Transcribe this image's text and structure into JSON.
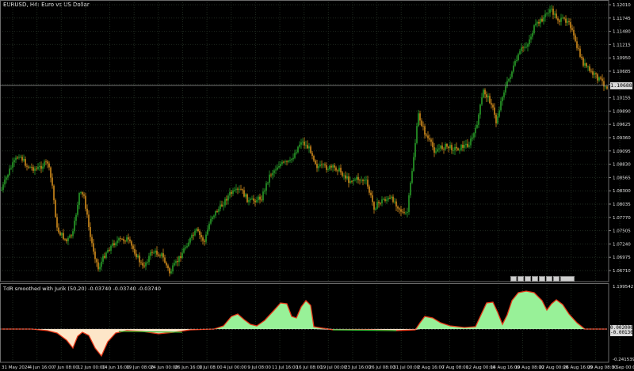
{
  "window": {
    "title": "EURUSD, H4: Euro vs US Dollar"
  },
  "indicator": {
    "label": "TdR smoothed with Jurik (50,20) -0.03740 -0.03740 -0.03740"
  },
  "price_axis": {
    "labels": [
      "1.12010",
      "1.11745",
      "1.11480",
      "1.11215",
      "1.10950",
      "1.10685",
      "1.10420",
      "1.10155",
      "1.09890",
      "1.09625",
      "1.09360",
      "1.09095",
      "1.08830",
      "1.08565",
      "1.08300",
      "1.08035",
      "1.07770",
      "1.07505",
      "1.07240",
      "1.06975",
      "1.06710"
    ],
    "current_price": "1.10688"
  },
  "indicator_axis": {
    "top": "1.199542",
    "tag1": "0.002000",
    "tag2": "-0.00130",
    "bottom": "-0.241539"
  },
  "time_axis": {
    "labels": [
      "31 May 2024",
      "4 Jun 16:00",
      "7 Jun 08:00",
      "12 Jun 00:00",
      "14 Jun 16:00",
      "19 Jun 08:00",
      "24 Jun 00:00",
      "26 Jun 16:00",
      "1 Jul 08:00",
      "4 Jul 00:00",
      "9 Jul 08:00",
      "11 Jul 16:00",
      "16 Jul 08:00",
      "19 Jul 00:00",
      "23 Jul 16:00",
      "26 Jul 08:00",
      "31 Jul 00:00",
      "2 Aug 16:00",
      "7 Aug 08:00",
      "12 Aug 00:00",
      "14 Aug 16:00",
      "19 Aug 08:00",
      "22 Aug 00:00",
      "26 Aug 16:00",
      "29 Aug 08:00",
      "3 Sep 00:00"
    ]
  },
  "colors": {
    "bull": "#2fb52f",
    "bear": "#f0a020",
    "grid": "#1f2a1f",
    "osc_fill_pos": "#98f198",
    "osc_fill_neg": "#fde6c8",
    "osc_line": "#e83a1a"
  }
}
